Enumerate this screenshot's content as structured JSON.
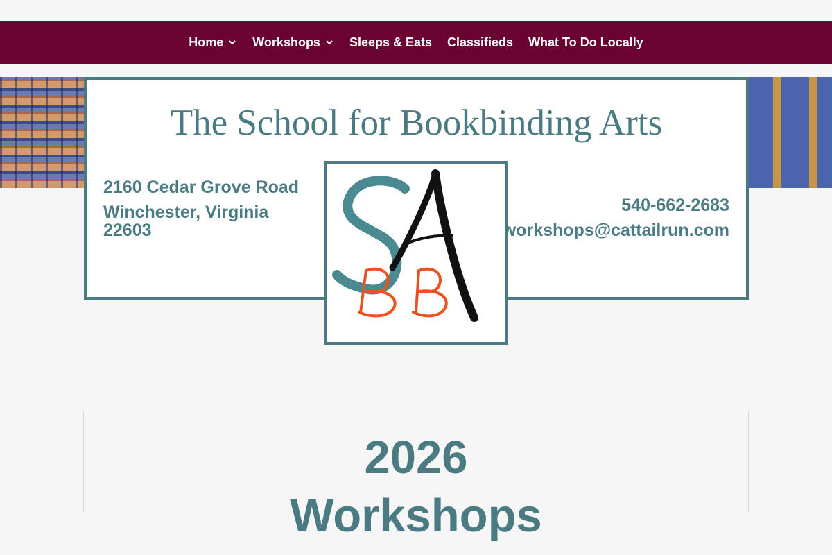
{
  "nav": {
    "items": [
      {
        "label": "Home",
        "has_dropdown": true
      },
      {
        "label": "Workshops",
        "has_dropdown": true
      },
      {
        "label": "Sleeps & Eats",
        "has_dropdown": false
      },
      {
        "label": "Classifieds",
        "has_dropdown": false
      },
      {
        "label": "What To Do Locally",
        "has_dropdown": false
      }
    ]
  },
  "header": {
    "title": "The School for Bookbinding Arts",
    "address_line1": "2160 Cedar Grove Road",
    "address_line2": "Winchester, Virginia 22603",
    "phone": "540-662-2683",
    "email": "workshops@cattailrun.com",
    "logo_text": "SABB"
  },
  "section": {
    "heading_line1": "2026",
    "heading_line2": "Workshops"
  },
  "colors": {
    "nav_bg": "#6b0332",
    "accent_teal": "#4a7b82",
    "logo_orange": "#e8531f",
    "page_bg": "#f6f6f6"
  },
  "icons": {
    "dropdown": "chevron-down-icon"
  }
}
